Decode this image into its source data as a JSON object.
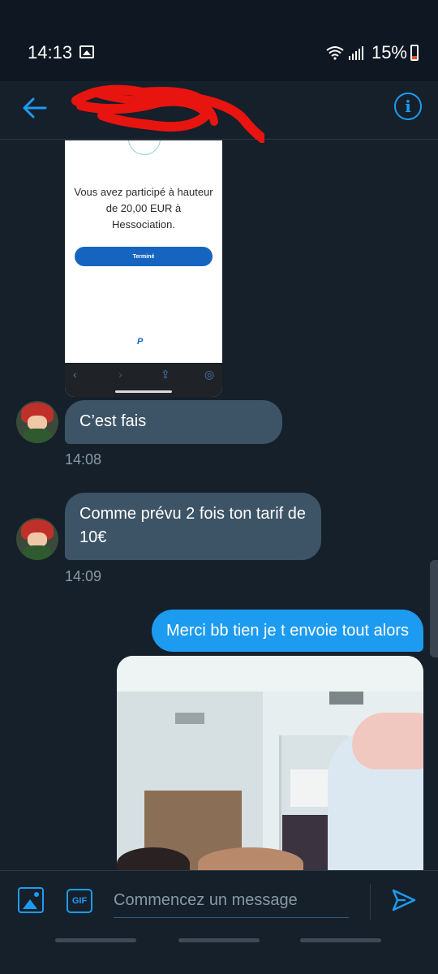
{
  "status_bar": {
    "time": "14:13",
    "battery": "15%"
  },
  "colors": {
    "accent": "#1d9bf0",
    "background": "#15202b",
    "incoming_bubble": "#3d5466",
    "redaction": "#e8140f"
  },
  "header": {
    "back_icon": "arrow-left-icon",
    "info_icon": "info-icon",
    "info_glyph": "i"
  },
  "shared_screenshot": {
    "message": "Vous avez participé à hauteur de 20,00 EUR à Hessociation.",
    "button_label": "Terminé",
    "logo": "P"
  },
  "messages": [
    {
      "direction": "in",
      "text": "C’est fais",
      "time": "14:08"
    },
    {
      "direction": "in",
      "text": "Comme prévu 2 fois ton tarif de 10€",
      "time": "14:09"
    },
    {
      "direction": "out",
      "text": "Merci bb tien je t envoie tout alors"
    }
  ],
  "composer": {
    "gif_label": "GIF",
    "placeholder": "Commencez un message"
  }
}
